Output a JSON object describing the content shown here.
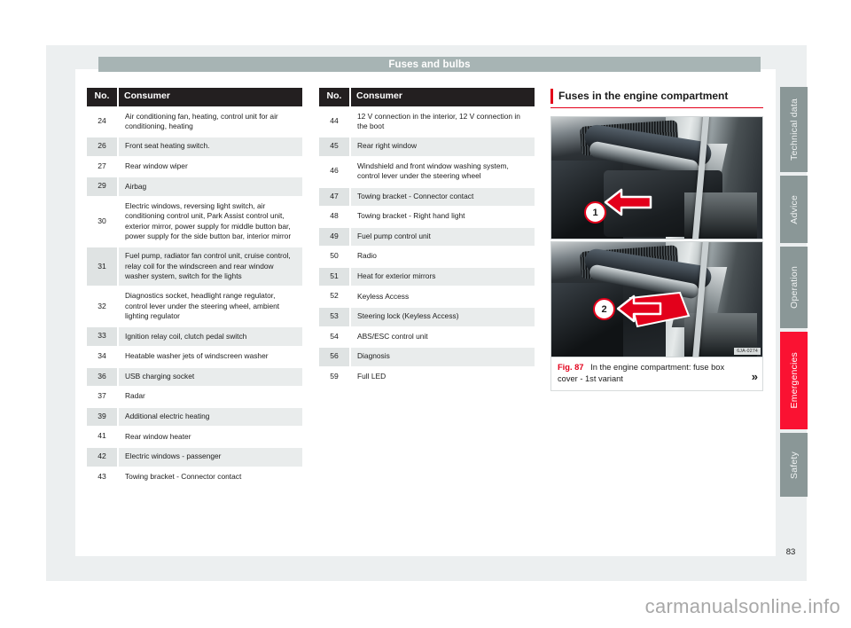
{
  "running_head": "Fuses and bulbs",
  "page_number": "83",
  "watermark": "carmanualsonline.info",
  "table_headers": {
    "no": "No.",
    "consumer": "Consumer"
  },
  "table_left": [
    {
      "no": "24",
      "consumer": "Air conditioning fan, heating, control unit for air conditioning, heating"
    },
    {
      "no": "26",
      "consumer": "Front seat heating switch."
    },
    {
      "no": "27",
      "consumer": "Rear window wiper"
    },
    {
      "no": "29",
      "consumer": "Airbag"
    },
    {
      "no": "30",
      "consumer": "Electric windows, reversing light switch, air conditioning control unit, Park Assist control unit, exterior mirror, power supply for middle button bar, power supply for the side button bar, interior mirror"
    },
    {
      "no": "31",
      "consumer": "Fuel pump, radiator fan control unit, cruise control, relay coil for the windscreen and rear window washer system, switch for the lights"
    },
    {
      "no": "32",
      "consumer": "Diagnostics socket, headlight range regulator, control lever under the steering wheel, ambient lighting regulator"
    },
    {
      "no": "33",
      "consumer": "Ignition relay coil, clutch pedal switch"
    },
    {
      "no": "34",
      "consumer": "Heatable washer jets of windscreen washer"
    },
    {
      "no": "36",
      "consumer": "USB charging socket"
    },
    {
      "no": "37",
      "consumer": "Radar"
    },
    {
      "no": "39",
      "consumer": "Additional electric heating"
    },
    {
      "no": "41",
      "consumer": "Rear window heater"
    },
    {
      "no": "42",
      "consumer": "Electric windows - passenger"
    },
    {
      "no": "43",
      "consumer": "Towing bracket - Connector contact"
    }
  ],
  "table_middle": [
    {
      "no": "44",
      "consumer": "12 V connection in the interior, 12 V connection in the boot"
    },
    {
      "no": "45",
      "consumer": "Rear right window"
    },
    {
      "no": "46",
      "consumer": "Windshield and front window washing system, control lever under the steering wheel"
    },
    {
      "no": "47",
      "consumer": "Towing bracket - Connector contact"
    },
    {
      "no": "48",
      "consumer": "Towing bracket - Right hand light"
    },
    {
      "no": "49",
      "consumer": "Fuel pump control unit"
    },
    {
      "no": "50",
      "consumer": "Radio"
    },
    {
      "no": "51",
      "consumer": "Heat for exterior mirrors"
    },
    {
      "no": "52",
      "consumer": "Keyless Access"
    },
    {
      "no": "53",
      "consumer": "Steering lock (Keyless Access)"
    },
    {
      "no": "54",
      "consumer": "ABS/ESC control unit"
    },
    {
      "no": "56",
      "consumer": "Diagnosis"
    },
    {
      "no": "59",
      "consumer": "Full LED"
    }
  ],
  "section": {
    "heading": "Fuses in the engine compartment",
    "figure": {
      "number": "Fig. 87",
      "caption": "In the engine compartment: fuse box cover - 1st variant",
      "continuation_marker": "»",
      "photo_code": "6JA-0274",
      "callout_1": "1",
      "callout_2": "2"
    }
  },
  "side_tabs": [
    {
      "label": "Technical data",
      "active": false
    },
    {
      "label": "Advice",
      "active": false
    },
    {
      "label": "Operation",
      "active": false
    },
    {
      "label": "Emergencies",
      "active": true
    },
    {
      "label": "Safety",
      "active": false
    }
  ],
  "colors": {
    "accent_red": "#e3001b",
    "tab_active": "#fa1232",
    "tab_inactive": "#8a9797",
    "running_head_bg": "#a7b4b4",
    "table_header_bg": "#231f20"
  }
}
